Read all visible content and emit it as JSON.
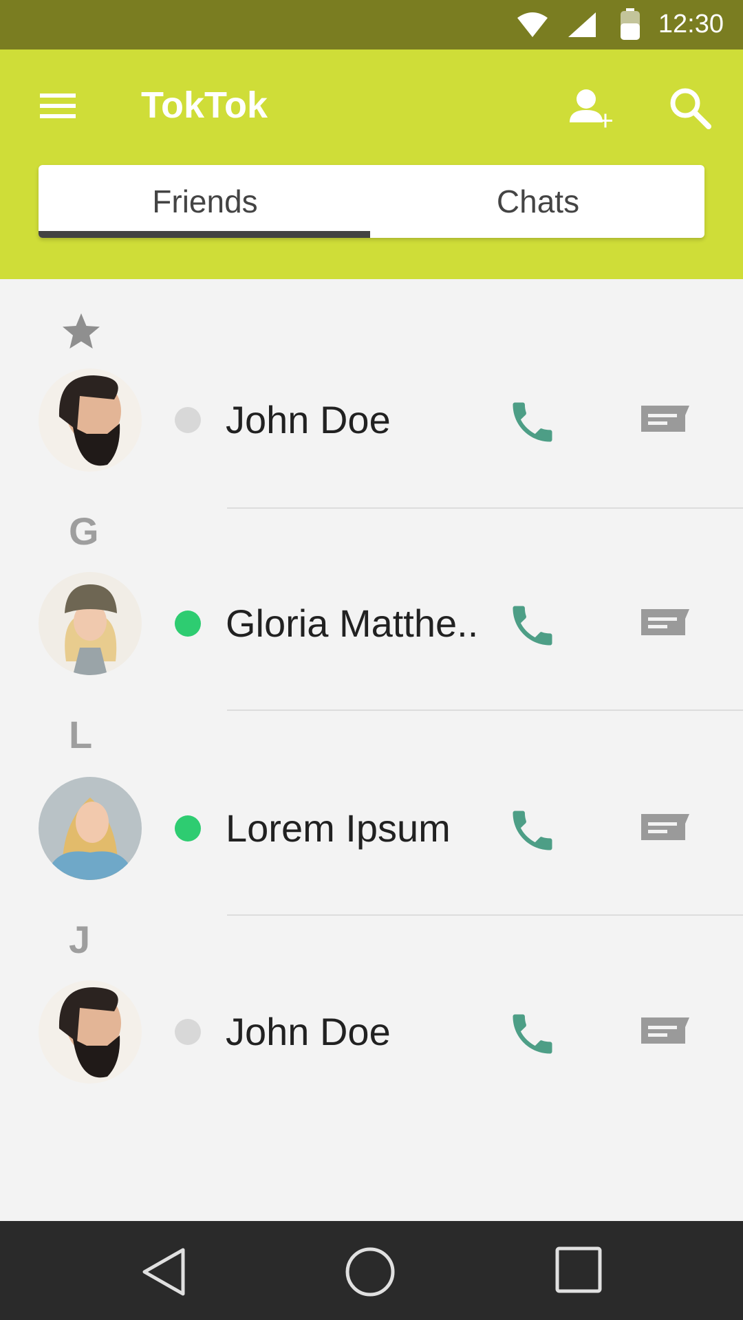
{
  "status_bar": {
    "time": "12:30",
    "icons": [
      "wifi-icon",
      "cell-signal-icon",
      "battery-icon"
    ]
  },
  "app_bar": {
    "title": "TokTok",
    "icons": [
      "menu-icon",
      "add-user-icon",
      "search-icon"
    ],
    "background_color": "#cfdd38"
  },
  "tabs": [
    {
      "label": "Friends",
      "selected": true
    },
    {
      "label": "Chats",
      "selected": false
    }
  ],
  "sections": [
    {
      "header": "",
      "header_icon": "star-icon",
      "contacts": [
        {
          "name": "John Doe",
          "online": false
        }
      ]
    },
    {
      "header": "G",
      "contacts": [
        {
          "name": "Gloria Matthe..",
          "online": true
        }
      ]
    },
    {
      "header": "L",
      "contacts": [
        {
          "name": "Lorem Ipsum",
          "online": true
        }
      ]
    },
    {
      "header": "J",
      "contacts": [
        {
          "name": "John Doe",
          "online": false
        }
      ]
    }
  ],
  "colors": {
    "online": "#2ecc71",
    "offline": "#d8d8d8",
    "call_icon": "#4d9e86",
    "message_icon": "#9a9a9a"
  },
  "nav_bar": {
    "icons": [
      "back-icon",
      "home-icon",
      "recents-icon"
    ]
  }
}
